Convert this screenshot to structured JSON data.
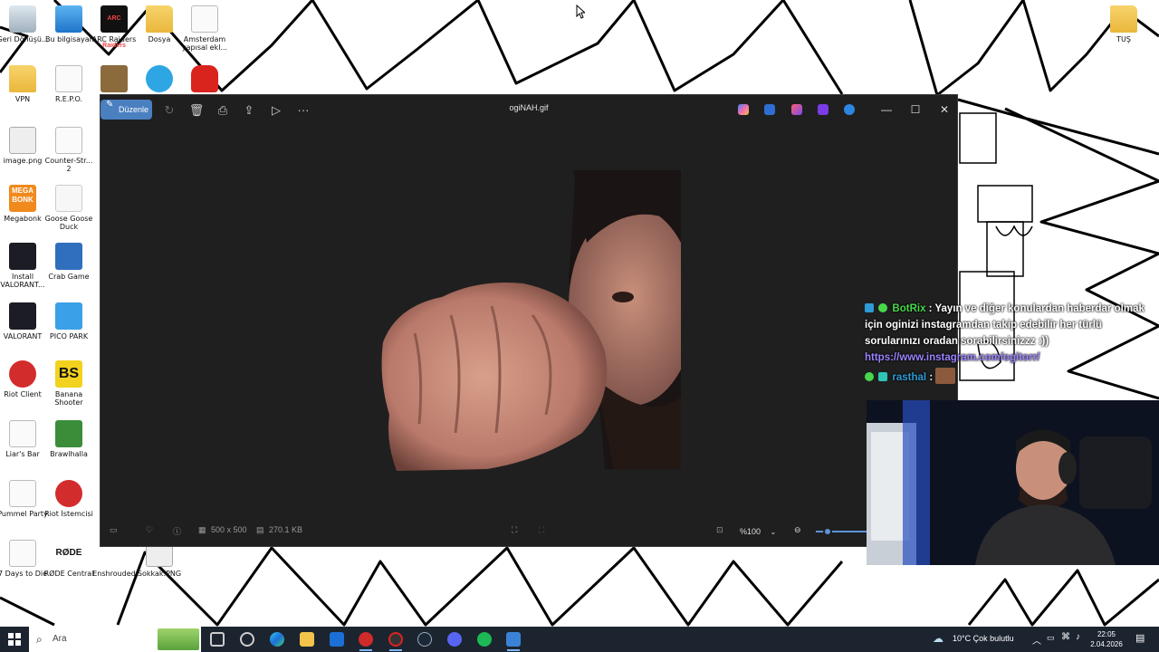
{
  "desktop": {
    "icons": [
      {
        "name": "recycle-bin",
        "label": "Geri Dönüşü..."
      },
      {
        "name": "this-pc",
        "label": "Bu bilgisayar"
      },
      {
        "name": "arc-raiders",
        "label": "ARC Raiders"
      },
      {
        "name": "folder-dosya",
        "label": "Dosya"
      },
      {
        "name": "amsterdam-file",
        "label": "Amsterdam yapısal ekl..."
      },
      {
        "name": "folder-vpn",
        "label": "VPN"
      },
      {
        "name": "repo-file",
        "label": "R.E.P.O."
      },
      {
        "name": "image-png",
        "label": "image.png"
      },
      {
        "name": "counter-strike",
        "label": "Counter-Str... 2"
      },
      {
        "name": "megabonk",
        "label": "Megabonk"
      },
      {
        "name": "goose-goose-duck",
        "label": "Goose Goose Duck"
      },
      {
        "name": "install-valorant",
        "label": "Install VALORANT..."
      },
      {
        "name": "crab-game",
        "label": "Crab Game"
      },
      {
        "name": "valorant",
        "label": "VALORANT"
      },
      {
        "name": "pico-park",
        "label": "PICO PARK"
      },
      {
        "name": "riot-client",
        "label": "Riot Client"
      },
      {
        "name": "banana-shooter",
        "label": "Banana Shooter"
      },
      {
        "name": "liars-bar",
        "label": "Liar's Bar"
      },
      {
        "name": "brawlhalla",
        "label": "Brawlhalla"
      },
      {
        "name": "pummel-party",
        "label": "Pummel Party"
      },
      {
        "name": "riot-istemcisi",
        "label": "Riot İstemcisi"
      },
      {
        "name": "7-days-to-die",
        "label": "7 Days to Die"
      },
      {
        "name": "rode-central",
        "label": "RØDE Central"
      },
      {
        "name": "enshrouded",
        "label": "Enshrouded"
      },
      {
        "name": "sokkak-png",
        "label": "Sokkak.PNG"
      },
      {
        "name": "folder-tus",
        "label": "TUŞ"
      }
    ],
    "rode_logo": "RØDE",
    "bs_logo": "BS",
    "mega_logo": "MEGA BONK",
    "arc_logo": "ARC Raiders"
  },
  "photos_window": {
    "edit_label": "Düzenle",
    "title": "ogiNAH.gif",
    "dimensions": "500 x 500",
    "file_size": "270.1 KB",
    "zoom": "%100"
  },
  "chat": {
    "messages": [
      {
        "user": "BotRix",
        "text": "Yayın ve diğer konulardan haberdar olmak için oginizi instagramdan takip edebilir her türlü sorularınızı oradan sorabilirsinizzz :))",
        "link": "https://www.instagram.com/ogitorr/"
      },
      {
        "user": "rasthal",
        "text": ":"
      }
    ]
  },
  "taskbar": {
    "search_placeholder": "Ara",
    "weather": "10°C  Çok bulutlu",
    "time": "22:05",
    "date": "2.04.2026"
  },
  "colors": {
    "accent": "#4a7fc0",
    "window_bg": "#1f1f1f",
    "taskbar_bg": "#1c2430",
    "chat_user1": "#47d84a",
    "chat_link": "#9b83ff"
  }
}
